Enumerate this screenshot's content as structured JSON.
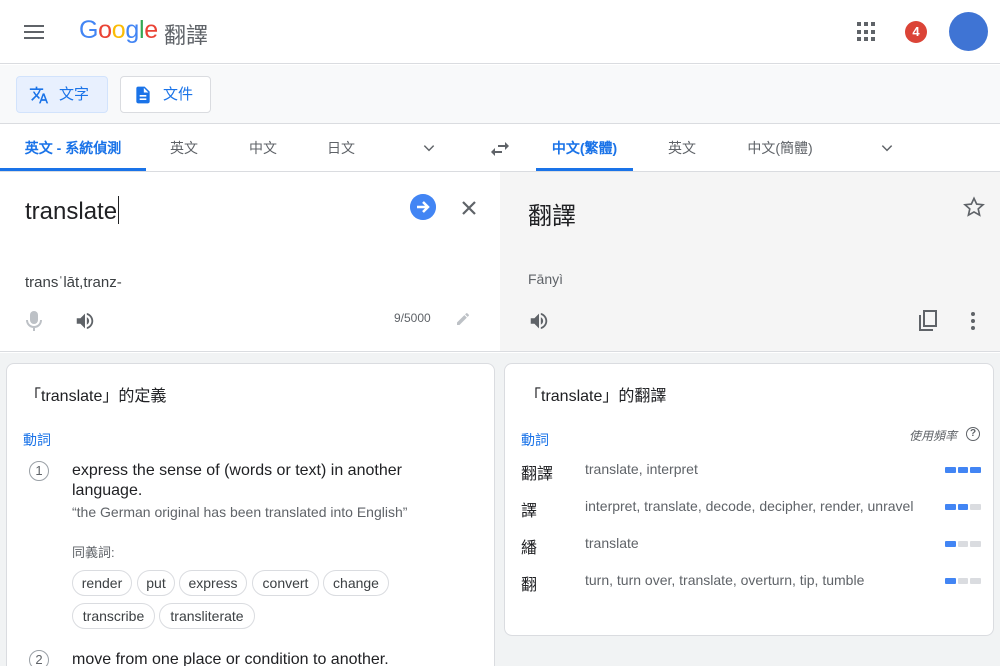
{
  "header": {
    "product_name": "翻譯",
    "notification_count": "4"
  },
  "modes": {
    "text_label": "文字",
    "document_label": "文件"
  },
  "languages": {
    "source_tabs": [
      "英文 - 系統偵測",
      "英文",
      "中文",
      "日文"
    ],
    "target_tabs": [
      "中文(繁體)",
      "英文",
      "中文(簡體)"
    ]
  },
  "source": {
    "text": "translate",
    "transliteration": "transˈlāt,tranz-",
    "char_count": "9/5000"
  },
  "target": {
    "text": "翻譯",
    "transliteration": "Fānyì"
  },
  "definitions": {
    "title": "「translate」的定義",
    "part_of_speech": "動詞",
    "entries": [
      {
        "number": "1",
        "text": "express the sense of (words or text) in another language.",
        "example": "“the German original has been translated into English”",
        "synonyms_label": "同義詞:",
        "synonyms": [
          "render",
          "put",
          "express",
          "convert",
          "change",
          "transcribe",
          "transliterate"
        ]
      },
      {
        "number": "2",
        "text": "move from one place or condition to another."
      }
    ]
  },
  "translations": {
    "title": "「translate」的翻譯",
    "part_of_speech": "動詞",
    "frequency_label": "使用頻率",
    "rows": [
      {
        "word": "翻譯",
        "back": "translate, interpret",
        "frequency": 3
      },
      {
        "word": "譯",
        "back": "interpret, translate, decode, decipher, render, unravel",
        "frequency": 2
      },
      {
        "word": "繙",
        "back": "translate",
        "frequency": 1
      },
      {
        "word": "翻",
        "back": "turn, turn over, translate, overturn, tip, tumble",
        "frequency": 1
      }
    ]
  }
}
